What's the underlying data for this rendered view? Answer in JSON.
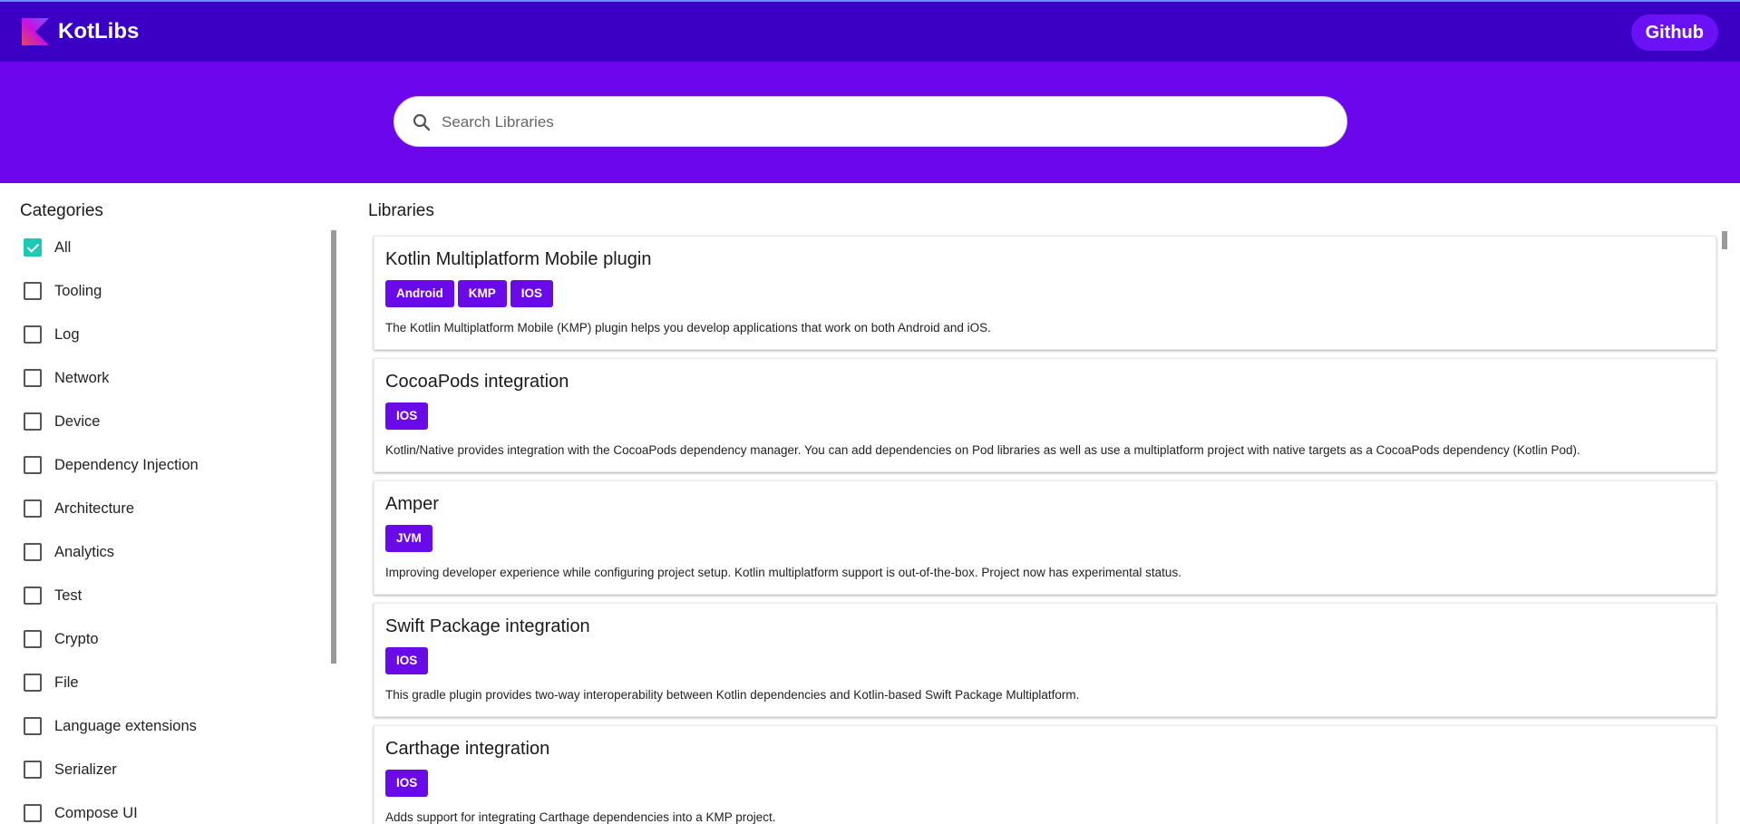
{
  "header": {
    "brand": "KotLibs",
    "github_label": "Github",
    "colors": {
      "topbar": "#3a00c4",
      "hero": "#6c06ec",
      "tag": "#6a0ae8",
      "checkbox": "#1cc9b6"
    }
  },
  "search": {
    "placeholder": "Search Libraries",
    "value": ""
  },
  "sidebar": {
    "title": "Categories",
    "categories": [
      {
        "label": "All",
        "checked": true
      },
      {
        "label": "Tooling",
        "checked": false
      },
      {
        "label": "Log",
        "checked": false
      },
      {
        "label": "Network",
        "checked": false
      },
      {
        "label": "Device",
        "checked": false
      },
      {
        "label": "Dependency Injection",
        "checked": false
      },
      {
        "label": "Architecture",
        "checked": false
      },
      {
        "label": "Analytics",
        "checked": false
      },
      {
        "label": "Test",
        "checked": false
      },
      {
        "label": "Crypto",
        "checked": false
      },
      {
        "label": "File",
        "checked": false
      },
      {
        "label": "Language extensions",
        "checked": false
      },
      {
        "label": "Serializer",
        "checked": false
      },
      {
        "label": "Compose UI",
        "checked": false
      }
    ]
  },
  "main": {
    "title": "Libraries",
    "libraries": [
      {
        "title": "Kotlin Multiplatform Mobile plugin",
        "tags": [
          "Android",
          "KMP",
          "IOS"
        ],
        "description": "The Kotlin Multiplatform Mobile (KMP) plugin helps you develop applications that work on both Android and iOS."
      },
      {
        "title": "CocoaPods integration",
        "tags": [
          "IOS"
        ],
        "description": "Kotlin/Native provides integration with the CocoaPods dependency manager. You can add dependencies on Pod libraries as well as use a multiplatform project with native targets as a CocoaPods dependency (Kotlin Pod)."
      },
      {
        "title": "Amper",
        "tags": [
          "JVM"
        ],
        "description": "Improving developer experience while configuring project setup. Kotlin multiplatform support is out-of-the-box. Project now has experimental status."
      },
      {
        "title": "Swift Package integration",
        "tags": [
          "IOS"
        ],
        "description": "This gradle plugin provides two-way interoperability between Kotlin dependencies and Kotlin-based Swift Package Multiplatform."
      },
      {
        "title": "Carthage integration",
        "tags": [
          "IOS"
        ],
        "description": "Adds support for integrating Carthage dependencies into a KMP project."
      }
    ]
  }
}
